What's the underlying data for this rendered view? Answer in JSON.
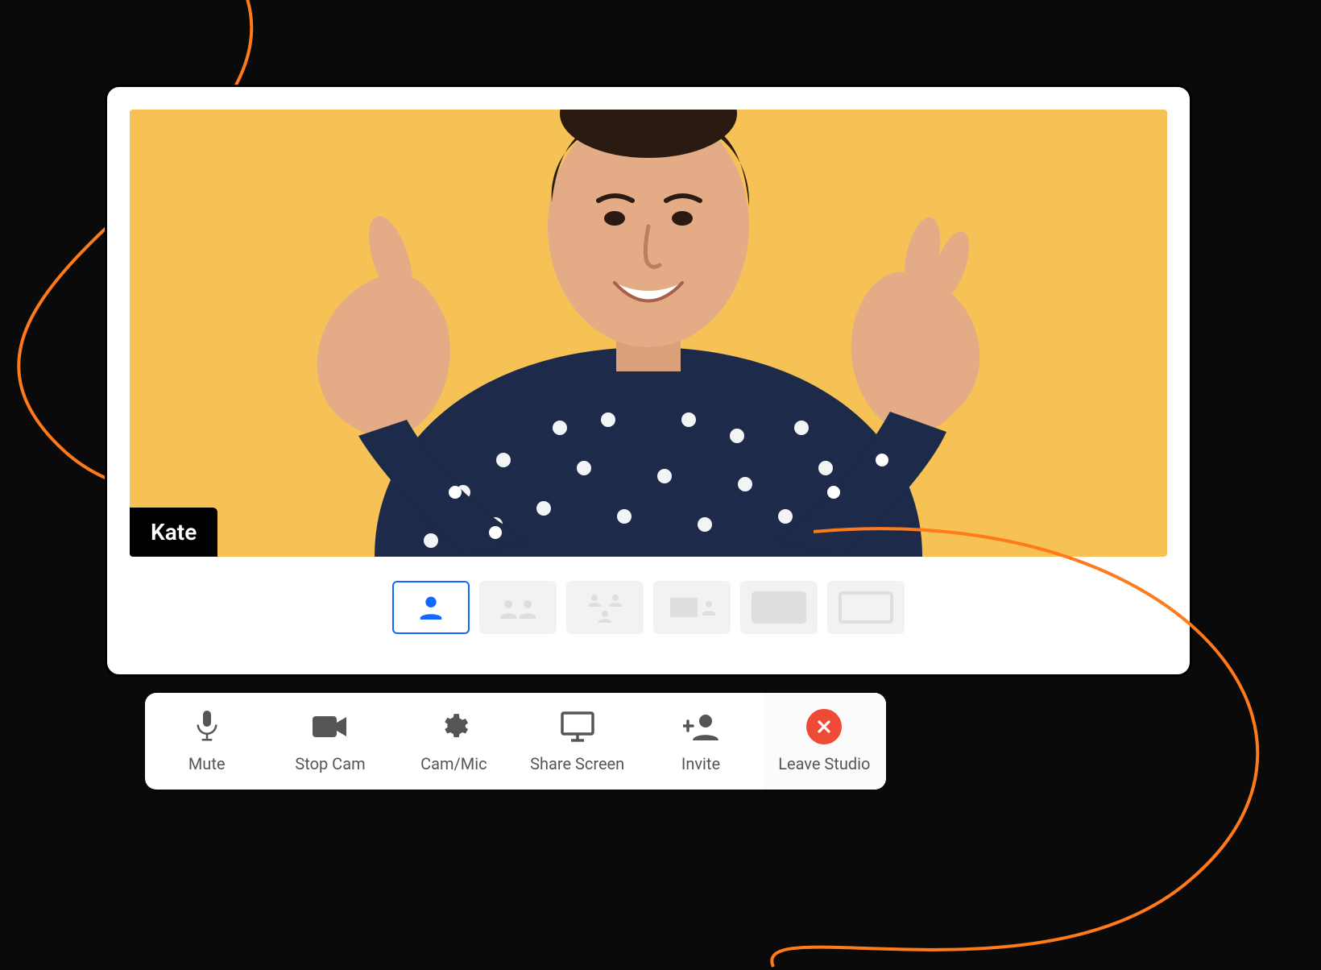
{
  "participant": {
    "name": "Kate"
  },
  "layouts": [
    {
      "id": "single",
      "active": true
    },
    {
      "id": "two-up",
      "active": false
    },
    {
      "id": "three",
      "active": false
    },
    {
      "id": "grid",
      "active": false
    },
    {
      "id": "pip",
      "active": false
    },
    {
      "id": "screen",
      "active": false
    }
  ],
  "toolbar": {
    "mute": {
      "label": "Mute"
    },
    "stop_cam": {
      "label": "Stop Cam"
    },
    "cam_mic": {
      "label": "Cam/Mic"
    },
    "share": {
      "label": "Share Screen"
    },
    "invite": {
      "label": "Invite"
    },
    "leave": {
      "label": "Leave Studio"
    }
  },
  "colors": {
    "accent": "#1168ff",
    "danger": "#ef4a35",
    "video_bg": "#f6c256",
    "curve": "#ff7a1a"
  }
}
